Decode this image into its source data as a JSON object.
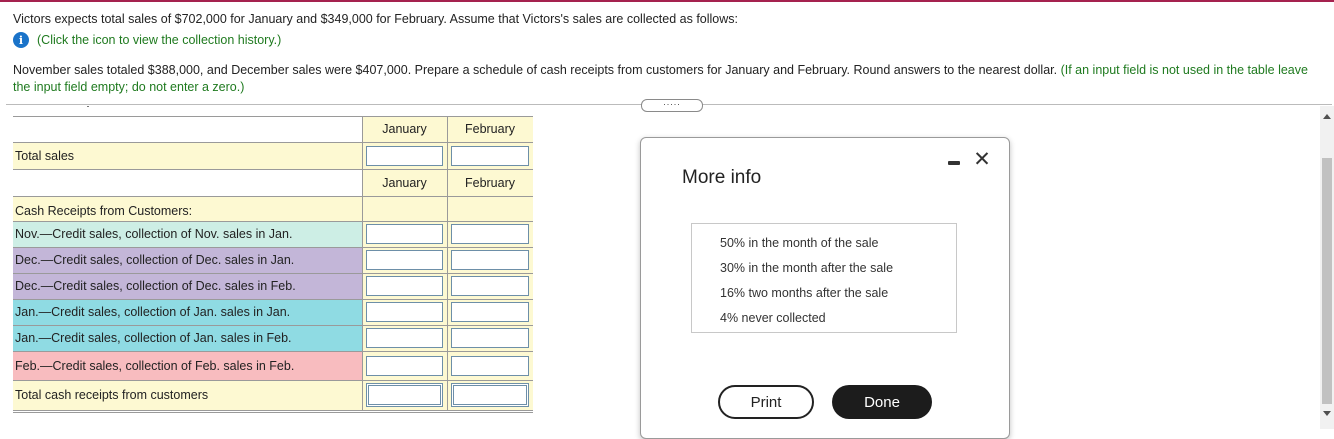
{
  "question": {
    "line1": "Victors expects total sales of $702,000 for January and $349,000 for February. Assume that Victors's sales are collected as follows:",
    "hint_icon": "info-icon",
    "hint": "(Click the icon to view the collection history.)",
    "line2_main": "November sales totaled $388,000, and December sales were $407,000. Prepare a schedule of cash receipts from customers for January and February. Round answers to the nearest dollar.",
    "line2_note": "(If an input field is not used in the table leave the input field empty; do not enter a zero.)",
    "expand_button": "....."
  },
  "table": {
    "col_headers": [
      "January",
      "February"
    ],
    "total_sales_label": "Total sales",
    "cash_receipts_heading": "Cash Receipts from Customers:",
    "rows": [
      {
        "label": "Nov.—Credit sales, collection of Nov. sales in Jan.",
        "color": "#cdeee5"
      },
      {
        "label": "Dec.—Credit sales, collection of Dec. sales in Jan.",
        "color": "#c3b6d8"
      },
      {
        "label": "Dec.—Credit sales, collection of Dec. sales in Feb.",
        "color": "#c3b6d8"
      },
      {
        "label": "Jan.—Credit sales, collection of Jan. sales in Jan.",
        "color": "#8fdbe3"
      },
      {
        "label": "Jan.—Credit sales, collection of Jan. sales in Feb.",
        "color": "#8fdbe3"
      },
      {
        "label": "Feb.—Credit sales, collection of Feb. sales in Feb.",
        "color": "#f8bcbf"
      }
    ],
    "total_receipts_label": "Total cash receipts from customers",
    "base_color": "#fdf9d2"
  },
  "modal": {
    "title": "More info",
    "lines": [
      "50% in the month of the sale",
      "30% in the month after the sale",
      "16% two months after the sale",
      "4% never collected"
    ],
    "print_label": "Print",
    "done_label": "Done",
    "minimize_icon": "minimize-icon",
    "close_icon": "close-icon",
    "close_glyph": "✕"
  }
}
